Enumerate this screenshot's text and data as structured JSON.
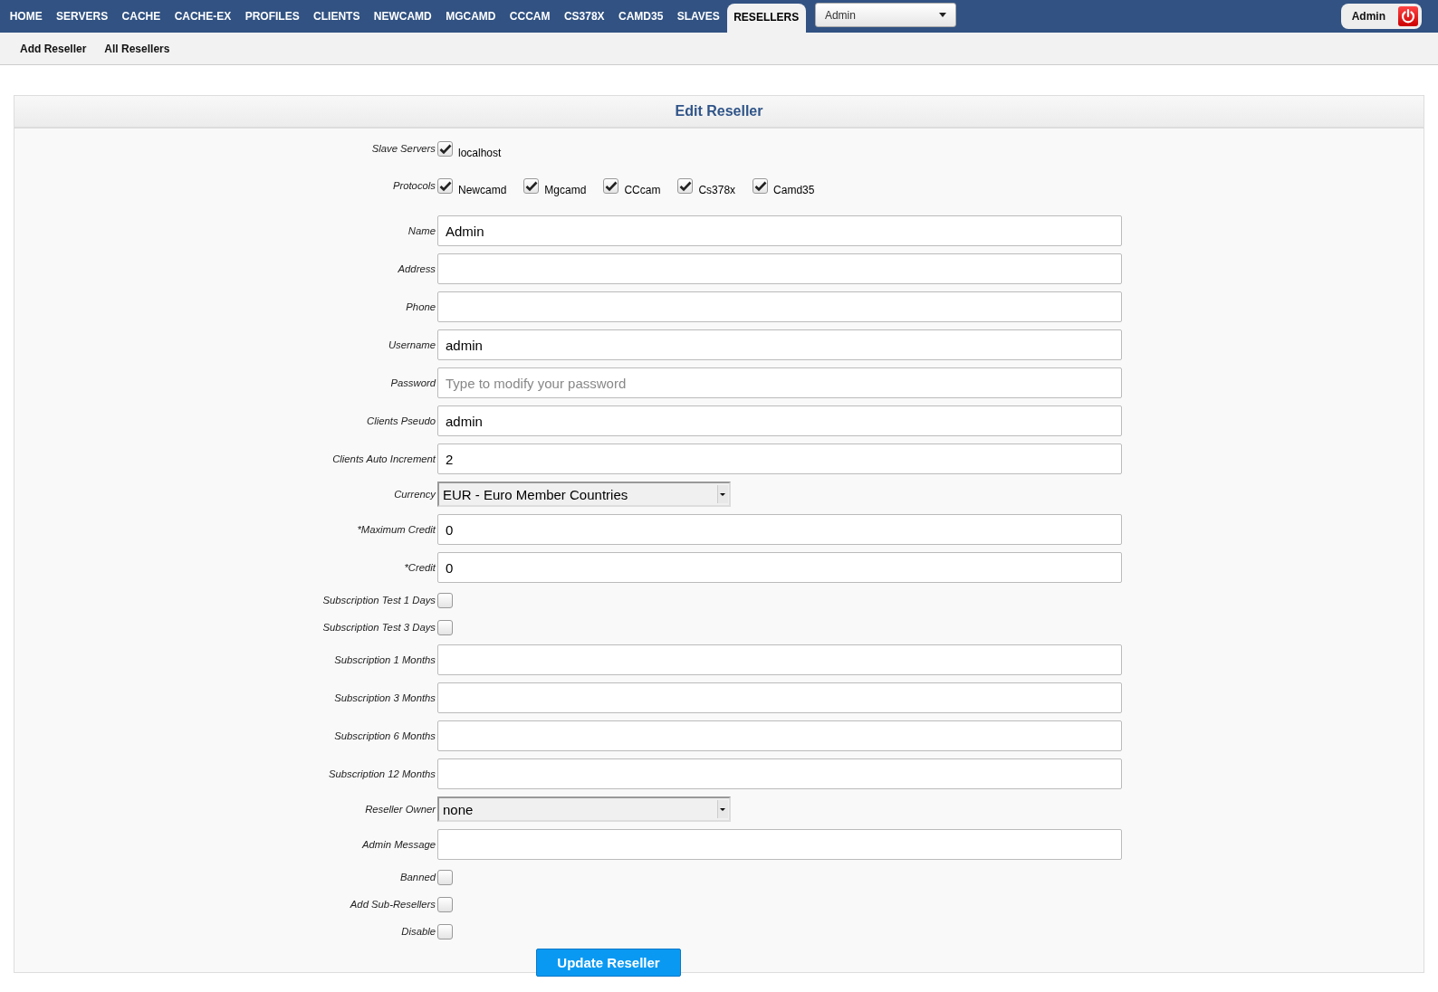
{
  "nav": {
    "tabs": [
      {
        "label": "HOME",
        "selected": false
      },
      {
        "label": "SERVERS",
        "selected": false
      },
      {
        "label": "CACHE",
        "selected": false
      },
      {
        "label": "CACHE-EX",
        "selected": false
      },
      {
        "label": "PROFILES",
        "selected": false
      },
      {
        "label": "CLIENTS",
        "selected": false
      },
      {
        "label": "NEWCAMD",
        "selected": false
      },
      {
        "label": "MGCAMD",
        "selected": false
      },
      {
        "label": "CCCAM",
        "selected": false
      },
      {
        "label": "CS378X",
        "selected": false
      },
      {
        "label": "CAMD35",
        "selected": false
      },
      {
        "label": "SLAVES",
        "selected": false
      },
      {
        "label": "RESELLERS",
        "selected": true
      }
    ],
    "dropdown": "Admin",
    "user": "Admin"
  },
  "subnav": [
    "Add Reseller",
    "All Resellers"
  ],
  "panel": {
    "title": "Edit Reseller",
    "rows": [
      {
        "kind": "checks",
        "label": "Slave Servers",
        "options": [
          {
            "label": "localhost",
            "checked": true
          }
        ]
      },
      {
        "kind": "checks",
        "label": "Protocols",
        "options": [
          {
            "label": "Newcamd",
            "checked": true
          },
          {
            "label": "Mgcamd",
            "checked": true
          },
          {
            "label": "CCcam",
            "checked": true
          },
          {
            "label": "Cs378x",
            "checked": true
          },
          {
            "label": "Camd35",
            "checked": true
          }
        ]
      },
      {
        "kind": "text",
        "label": "Name",
        "value": "Admin"
      },
      {
        "kind": "text",
        "label": "Address"
      },
      {
        "kind": "text",
        "label": "Phone"
      },
      {
        "kind": "text",
        "label": "Username",
        "value": "admin"
      },
      {
        "kind": "text",
        "label": "Password",
        "placeholder": "Type to modify your password"
      },
      {
        "kind": "text",
        "label": "Clients Pseudo",
        "value": "admin"
      },
      {
        "kind": "text",
        "label": "Clients Auto Increment",
        "value": "2"
      },
      {
        "kind": "select",
        "label": "Currency",
        "value": "EUR - Euro Member Countries"
      },
      {
        "kind": "text",
        "label": "*Maximum Credit",
        "value": "0"
      },
      {
        "kind": "text",
        "label": "*Credit",
        "value": "0"
      },
      {
        "kind": "checkbox",
        "label": "Subscription Test 1 Days",
        "checked": false
      },
      {
        "kind": "checkbox",
        "label": "Subscription Test 3 Days",
        "checked": false
      },
      {
        "kind": "text",
        "label": "Subscription 1 Months"
      },
      {
        "kind": "text",
        "label": "Subscription 3 Months"
      },
      {
        "kind": "text",
        "label": "Subscription 6 Months"
      },
      {
        "kind": "text",
        "label": "Subscription 12 Months"
      },
      {
        "kind": "select",
        "label": "Reseller Owner",
        "value": "none"
      },
      {
        "kind": "text",
        "label": "Admin Message"
      },
      {
        "kind": "checkbox",
        "label": "Banned",
        "checked": false
      },
      {
        "kind": "checkbox",
        "label": "Add Sub-Resellers",
        "checked": false
      },
      {
        "kind": "checkbox",
        "label": "Disable",
        "checked": false
      }
    ],
    "submit": "Update Reseller"
  }
}
